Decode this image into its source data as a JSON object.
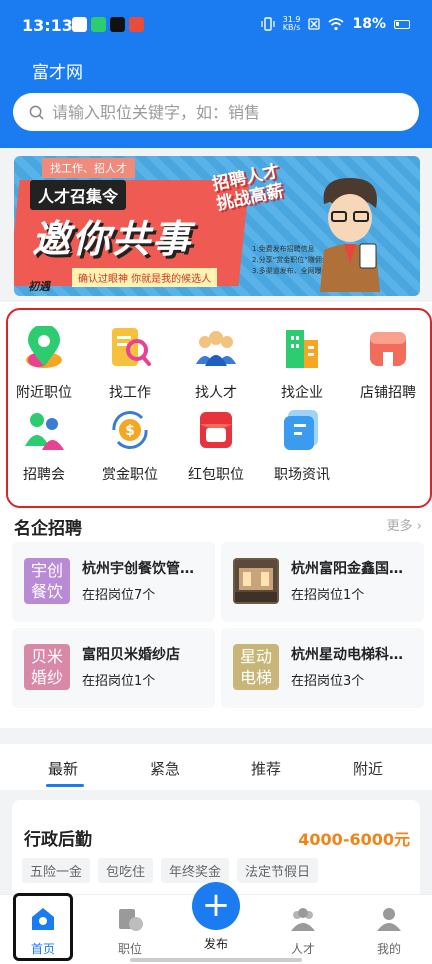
{
  "status_bar": {
    "time": "13:13",
    "net_speed": "31.9",
    "net_unit": "KB/s",
    "battery": "18%"
  },
  "header": {
    "title": "富才网",
    "search_placeholder": "请输入职位关键字，如：销售"
  },
  "banner": {
    "tag_top": "找工作、招人才",
    "tag_title": "人才召集令",
    "main_text": "邀你共事",
    "slogan_line1": "招聘人才",
    "slogan_line2": "挑战高薪",
    "sub_text": "确认过眼神 你就是我的候选人",
    "logo_text": "初遇",
    "notes": [
      "1.免费发布招聘信息",
      "2.分享“赏金职位”赚佣金",
      "3.多渠道发布、全网曝光"
    ]
  },
  "menu": {
    "items": [
      {
        "label": "附近职位",
        "icon": "location-icon"
      },
      {
        "label": "找工作",
        "icon": "search-job-icon"
      },
      {
        "label": "找人才",
        "icon": "people-icon"
      },
      {
        "label": "找企业",
        "icon": "building-icon"
      },
      {
        "label": "店铺招聘",
        "icon": "store-icon"
      },
      {
        "label": "招聘会",
        "icon": "fair-icon"
      },
      {
        "label": "赏金职位",
        "icon": "bounty-icon"
      },
      {
        "label": "红包职位",
        "icon": "red-packet-icon"
      },
      {
        "label": "职场资讯",
        "icon": "news-icon"
      }
    ]
  },
  "companies": {
    "title": "名企招聘",
    "more": "更多",
    "items": [
      {
        "logo_text": "宇创餐饮",
        "name": "杭州宇创餐饮管…",
        "count": "在招岗位7个",
        "color": "#b98ad6"
      },
      {
        "logo_text": "",
        "name": "杭州富阳金鑫国…",
        "count": "在招岗位1个",
        "color": "#6b5a48"
      },
      {
        "logo_text": "贝米婚纱",
        "name": "富阳贝米婚纱店",
        "count": "在招岗位1个",
        "color": "#d889a8"
      },
      {
        "logo_text": "星动电梯",
        "name": "杭州星动电梯科…",
        "count": "在招岗位3个",
        "color": "#c8b678"
      }
    ]
  },
  "tabs": [
    "最新",
    "紧急",
    "推荐",
    "附近"
  ],
  "job": {
    "title": "行政后勤",
    "salary": "4000-6000元",
    "tags": [
      "五险一金",
      "包吃住",
      "年终奖金",
      "法定节假日"
    ]
  },
  "bottom_nav": {
    "home": "首页",
    "jobs": "职位",
    "publish": "发布",
    "talent": "人才",
    "mine": "我的",
    "publish_symbol": "+"
  },
  "colors": {
    "primary": "#1a7cf0",
    "salary": "#f08418",
    "highlight": "#d9232d"
  }
}
